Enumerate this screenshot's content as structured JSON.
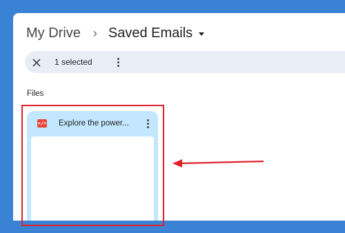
{
  "breadcrumb": {
    "root": "My Drive",
    "separator": "›",
    "current": "Saved Emails"
  },
  "selection": {
    "count_label": "1 selected"
  },
  "files_section": {
    "label": "Files"
  },
  "files": [
    {
      "icon": "code-file-icon",
      "icon_glyph": "</>",
      "title": "Explore the power..."
    }
  ],
  "colors": {
    "background": "#3a82d4",
    "selection_bar": "#e9eef6",
    "selected_card": "#c2e7ff",
    "annotation": "#e0202a",
    "file_icon": "#ea4335"
  }
}
